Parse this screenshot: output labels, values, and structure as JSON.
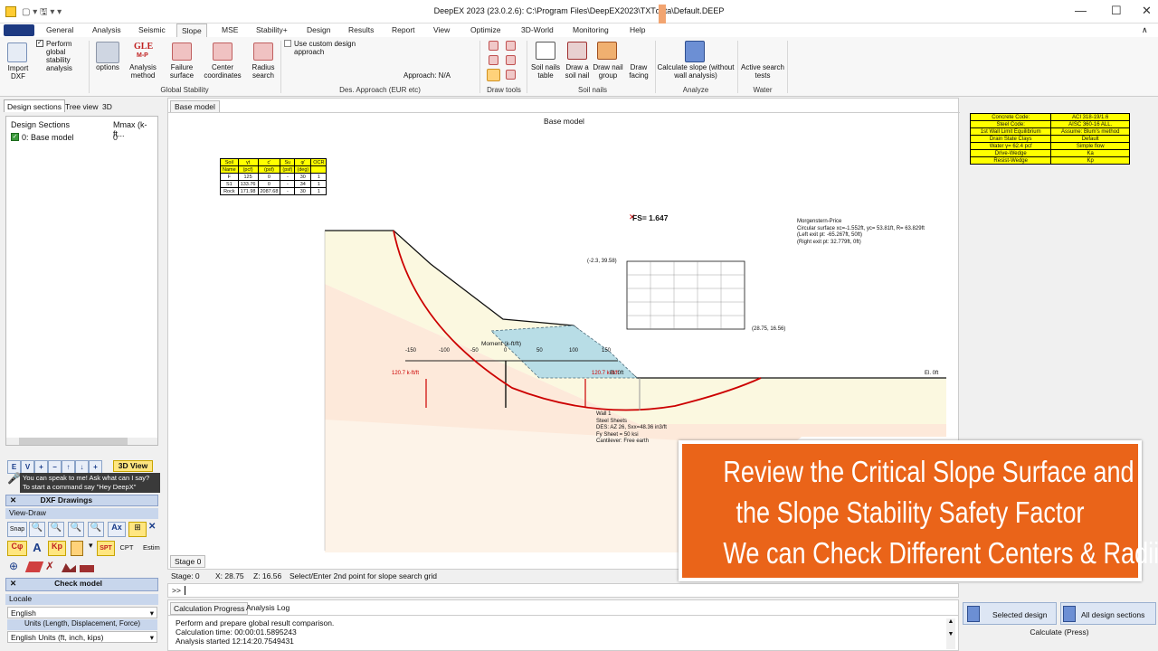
{
  "window": {
    "title": "DeepEX 2023  (23.0.2.6): C:\\Program Files\\DeepEX2023\\TXTdata\\Default.DEEP"
  },
  "menu_tabs": [
    "General",
    "Analysis",
    "Seismic",
    "Slope",
    "MSE",
    "Stability+",
    "Design",
    "Results",
    "Report",
    "View",
    "Optimize",
    "3D-World",
    "Monitoring",
    "Help"
  ],
  "active_tab": "Slope",
  "ribbon": {
    "import_dxf": "Import DXF",
    "perform_global": "Perform global stability analysis",
    "options": "options",
    "analysis_method": "Analysis method",
    "gle": "GLE",
    "mp": "M-P",
    "failure_surface": "Failure surface",
    "center_coordinates": "Center coordinates",
    "radius_search": "Radius search",
    "global_stability": "Global Stability",
    "use_custom_design": "Use custom design approach",
    "approach": "Approach: N/A",
    "des_approach": "Des. Approach (EUR etc)",
    "draw_tools": "Draw tools",
    "soil_nails_table": "Soil nails table",
    "draw_soil_nail": "Draw a soil nail",
    "draw_nail_group": "Draw nail group",
    "draw_facing": "Draw facing",
    "soil_nails": "Soil nails",
    "calculate_slope": "Calculate slope (without wall analysis)",
    "analyze": "Analyze",
    "active_search": "Active search tests",
    "water": "Water"
  },
  "left": {
    "tabs": [
      "Design sections",
      "Tree view",
      "3D"
    ],
    "col1": "Design Sections",
    "col2": "Mmax (k-ft...",
    "row_name": "0: Base model",
    "row_val": "0",
    "view3d": "3D View",
    "speak": "You can speak to me! Ask what can I say?",
    "speak2": "To start a command say \"Hey DeepX\"",
    "dxf": "DXF Drawings",
    "viewdraw": "View-Draw",
    "snap": "Snap",
    "spt": "SPT",
    "cpt": "CPT",
    "estim": "Estim",
    "check": "Check model",
    "locale": "Locale",
    "lang": "English",
    "units_label": "Units (Length, Displacement, Force)",
    "units": "English Units (ft, inch, kips)"
  },
  "main": {
    "tab": "Base model",
    "drawing_title": "Base model",
    "fs": "FS= 1.647",
    "method": "Morgenstern-Price",
    "circ": "Circular surface xc=-1.552ft, yc= 53.81ft, R= 63.829ft",
    "left_exit": "(Left exit pt: -65.267ft, 50ft)",
    "right_exit": "(Right exit pt: 32.779ft, 0ft)",
    "grid_tl": "(-2.3, 39.58)",
    "grid_br": "(28.75, 16.56)",
    "moment": "Moment (k-ft/ft)",
    "axis_ticks": [
      "-150",
      "-100",
      "-50",
      "0",
      "50",
      "100",
      "150"
    ],
    "mom_left": "120.7 k-ft/ft",
    "mom_right": "120.7 k-ft/ft",
    "el0": "El. 0ft",
    "el0b": "El. 0ft",
    "wall": [
      "Wall 1",
      "Steel Sheets",
      "DES: AZ 26, Sxx=48.36 in3/ft",
      "Fy Sheet = 50 ksi",
      "Cantilever: Free earth"
    ],
    "stage_tab": "Stage 0",
    "soil_headers": [
      "Soil",
      "γt",
      "c'",
      "Su",
      "φ'",
      "OCR"
    ],
    "soil_units": [
      "Name",
      "(pcf)",
      "(psf)",
      "(psf)",
      "(deg)",
      ""
    ],
    "soil_rows": [
      [
        "F",
        "125",
        "0",
        "-",
        "30",
        "1"
      ],
      [
        "S1",
        "133.76",
        "0",
        "-",
        "34",
        "1"
      ],
      [
        "Rock",
        "171.98",
        "2087.68",
        "-",
        "30",
        "1"
      ]
    ],
    "code_rows": [
      [
        "Concrete Code:",
        "ACI 318-19/1.6"
      ],
      [
        "Steel Code:",
        "AISC 360-16 ALL."
      ],
      [
        "1st Wall Limit Equilibrium",
        "Assume: Blum's method"
      ],
      [
        "Drain State Clays",
        "Default"
      ],
      [
        "Water γ= 62.4 pcf",
        "Simple flow"
      ],
      [
        "Drive-Wedge",
        "Ka"
      ],
      [
        "Resist-Wedge",
        "Kp"
      ]
    ]
  },
  "status": {
    "stage": "Stage: 0",
    "x": "X: 28.75",
    "z": "Z: 16.56",
    "msg": "Select/Enter 2nd point for slope search grid",
    "prompt": ">>"
  },
  "bottom": {
    "tabs": [
      "Calculation Progress",
      "Analysis Log"
    ],
    "lines": [
      "Perform and prepare global result comparison.",
      "Calculation time: 00:00:01.5895243",
      "Analysis started 12:14:20.7549431"
    ]
  },
  "calc": {
    "selected": "Selected design",
    "all": "All design sections",
    "label": "Calculate (Press)"
  },
  "overlay": [
    "Review the Critical Slope Surface and",
    "the Slope Stability Safety Factor",
    "We can Check Different Centers & Radii"
  ],
  "colors": {
    "overlay": "#ea6419",
    "codebox": "#ffff00",
    "slip": "#cc0000",
    "wedge": "#b8dde6"
  }
}
